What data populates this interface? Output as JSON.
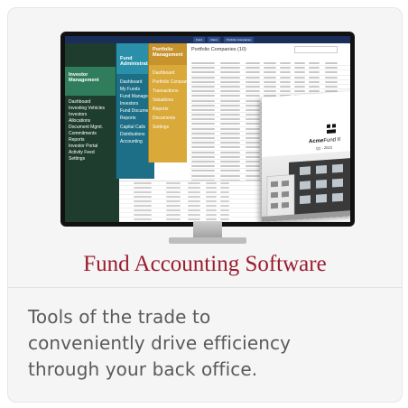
{
  "card": {
    "title": "Fund Accounting Software",
    "description_lines": [
      "Tools of the trade to",
      "conveniently drive efficiency",
      "through your back office."
    ]
  },
  "screen": {
    "tabs": [
      "Fund",
      "Client",
      "Portfolio Companies"
    ],
    "content_title": "Portfolio Companies (10)",
    "nav_green": {
      "heading": "Investor Management",
      "items": [
        "Dashboard",
        "Investing Vehicles",
        "Investors",
        "Allocations",
        "Document Mgmt.",
        "Commitments",
        "Reports",
        "Investor Portal",
        "Activity Feed",
        "Settings"
      ]
    },
    "nav_teal": {
      "heading": "Fund Administration",
      "items": [
        "Dashboard",
        "My Funds",
        "Fund Manager",
        "Investors",
        "Fund Documents",
        "Reports",
        "Capital Calls",
        "Distributions",
        "Accounting"
      ]
    },
    "nav_gold": {
      "heading": "Portfolio Management",
      "items": [
        "Dashboard",
        "Portfolio Companies",
        "Transactions",
        "Valuations",
        "Reports",
        "Documents",
        "Settings"
      ]
    },
    "brochure": {
      "brand_bold": "Acme",
      "brand_rest": "Fund II",
      "quarter": "Q2 - 2023"
    }
  },
  "colors": {
    "title": "#9c1b2e",
    "text": "#5a5a5a",
    "nav_green": "#1f3d2e",
    "nav_teal": "#1c6f86",
    "nav_gold": "#d9a93a",
    "title_bar": "#1a2e5a"
  },
  "icons": [
    "acme-logo-icon",
    "building-photo"
  ]
}
